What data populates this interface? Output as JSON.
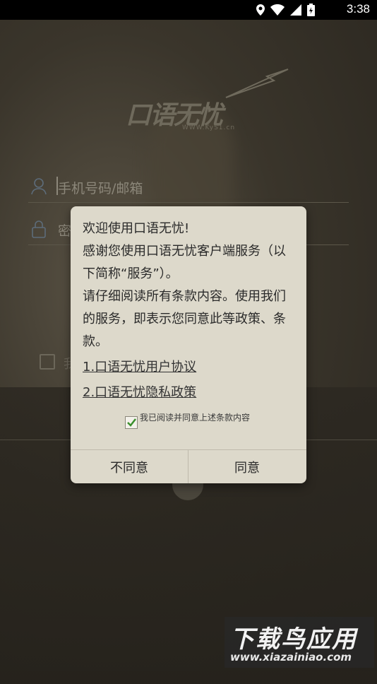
{
  "status_bar": {
    "time": "3:38",
    "icons": [
      "location-icon",
      "wifi-icon",
      "signal-icon",
      "battery-icon"
    ]
  },
  "logo": {
    "text": "口语无忧",
    "url": "WWW.KyS1.cn"
  },
  "form": {
    "username_placeholder": "手机号码/邮箱",
    "password_placeholder": "密",
    "remember_label": "我"
  },
  "dialog": {
    "welcome": "欢迎使用口语无忧!",
    "paragraph1": "感谢您使用口语无忧客户端服务（以下简称“服务”）。",
    "paragraph2": "请仔细阅读所有条款内容。使用我们的服务，即表示您同意此等政策、条款。",
    "link_user_agreement": "1.口语无忧用户协议",
    "link_privacy_policy": "2.口语无忧隐私政策",
    "agree_checkbox_label": "我已阅读并同意上述条款内容",
    "agree_checked": true,
    "disagree_button": "不同意",
    "agree_button": "同意"
  },
  "watermark": {
    "title": "下载鸟应用",
    "url": "www.xiazainiao.com"
  },
  "colors": {
    "dialog_bg": "#ddd9cb",
    "check_green": "#3a8f2c",
    "status_bar": "#000000"
  }
}
